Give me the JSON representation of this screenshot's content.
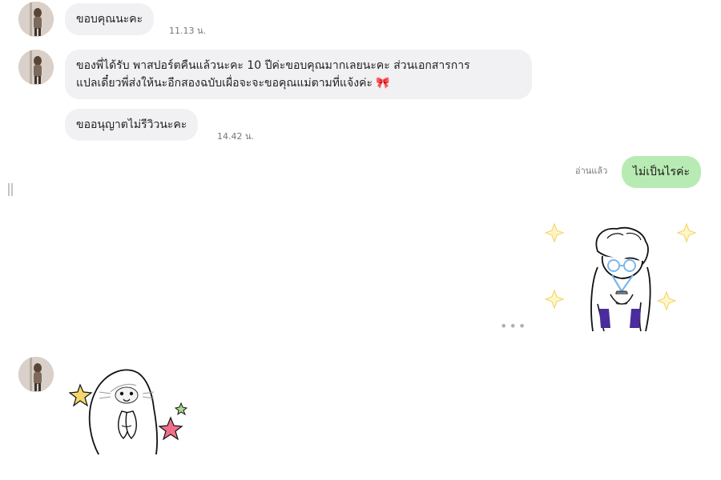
{
  "messages": [
    {
      "text": "ขอบคุณนะคะ",
      "time": "11.13 น."
    },
    {
      "line1": "ของพี่ได้รับ พาสปอร์ตคืนแล้วนะคะ 10 ปีค่ะขอบคุณมากเลยนะคะ ส่วนเอกสารการ",
      "line2": "แปลเดี๋ยวพี่ส่งให้นะอีกสองฉบับเผื่อจะจะขอคุณแม่ตามที่แจ้งค่ะ",
      "emoji": "🎀"
    },
    {
      "text": "ขออนุญาตไม่รีวิวนะคะ",
      "time": "14.42 น."
    }
  ],
  "outgoing": {
    "text": "ไม่เป็นไรค่ะ",
    "read_label": "อ่านแล้ว"
  },
  "icons": {
    "more": "more-options-icon",
    "pause": "pause-icon",
    "colors": {
      "bubble_gray": "#f1f1f3",
      "bubble_green": "#b8ebb3",
      "star_yellow": "#f6d76b",
      "star_pink": "#ef6f8a",
      "star_green": "#a9dc8c",
      "purple": "#4b2c9c",
      "blue": "#7bb6ec"
    }
  }
}
